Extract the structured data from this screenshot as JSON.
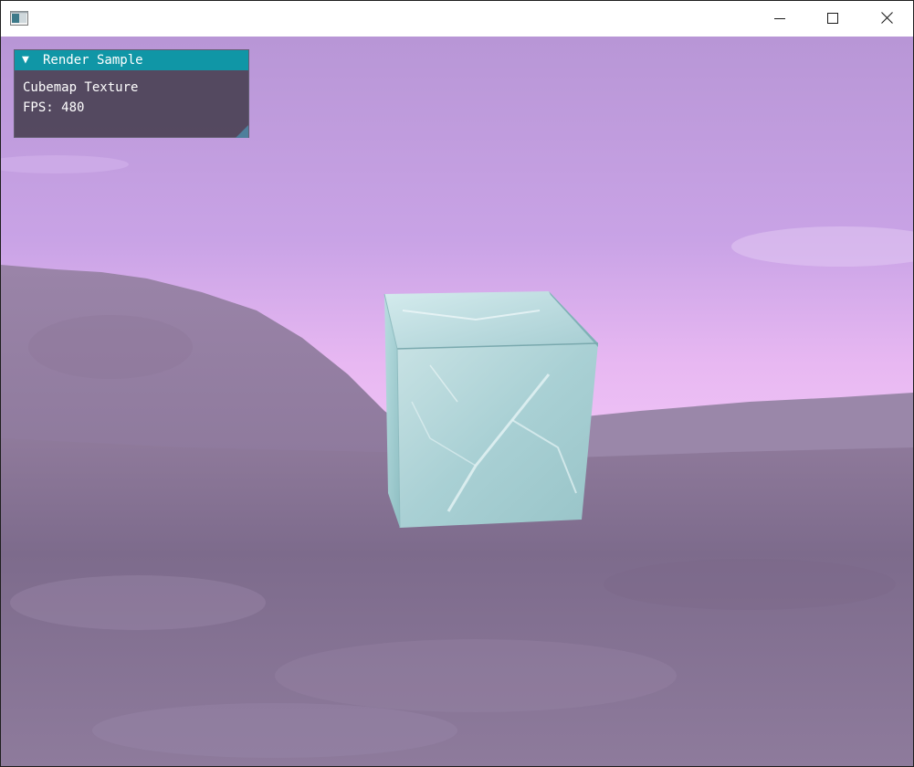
{
  "window": {
    "icon": "app-window-icon",
    "controls": {
      "minimize_icon": "minimize-icon",
      "maximize_icon": "maximize-icon",
      "close_icon": "close-icon"
    }
  },
  "panel": {
    "collapse_glyph": "▼",
    "title": "Render Sample",
    "lines": [
      "Cubemap Texture",
      "FPS: 480"
    ],
    "title_color": "#1096a6"
  },
  "scene": {
    "sky_color": "#c9a3e6",
    "terrain_color": "#8f7a9b",
    "cube_color": "#b5d8dc"
  }
}
